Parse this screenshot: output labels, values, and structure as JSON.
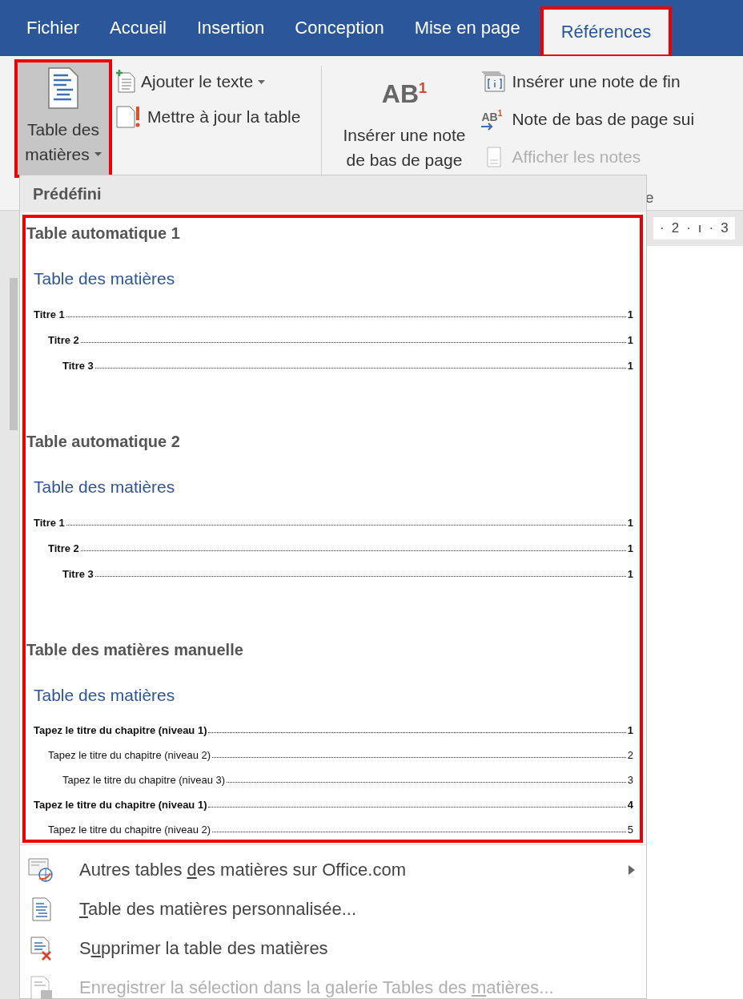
{
  "tabs": [
    {
      "label": "Fichier",
      "selected": false,
      "annotated": false
    },
    {
      "label": "Accueil",
      "selected": false,
      "annotated": false
    },
    {
      "label": "Insertion",
      "selected": false,
      "annotated": false
    },
    {
      "label": "Conception",
      "selected": false,
      "annotated": false
    },
    {
      "label": "Mise en page",
      "selected": false,
      "annotated": false
    },
    {
      "label": "Références",
      "selected": true,
      "annotated": true
    }
  ],
  "ribbon": {
    "toc_group": {
      "big_button": {
        "label_lines": [
          "Table des",
          "matières"
        ],
        "caret": true,
        "pressed": true,
        "annotated": true
      },
      "small_buttons": [
        {
          "label": "Ajouter le texte",
          "caret": true,
          "disabled": false
        },
        {
          "label": "Mettre à jour la table",
          "caret": false,
          "disabled": false
        }
      ]
    },
    "notes_group": {
      "big_button": {
        "icon_text": "AB$^{1}$",
        "label_lines": [
          "Insérer une note",
          "de bas de page"
        ]
      },
      "small_buttons": [
        {
          "label": "Insérer une note de fin",
          "disabled": false
        },
        {
          "label": "Note de bas de page sui",
          "icon_text": "AB$^{1}$",
          "disabled": false
        },
        {
          "label": "Afficher les notes",
          "disabled": true
        }
      ],
      "label": "e"
    }
  },
  "ruler": {
    "marks": [
      "·",
      "2",
      "·",
      "ı",
      "·",
      "3"
    ]
  },
  "dropdown": {
    "header": "Prédéfini",
    "gallery_annotated": true,
    "gallery": [
      {
        "title": "Table automatique 1",
        "heading": "Table des matières",
        "entries": [
          {
            "text": "Titre 1",
            "page": "1",
            "bold": true,
            "children": [
              {
                "text": "Titre 2",
                "page": "1",
                "bold": true,
                "children": [
                  {
                    "text": "Titre 3",
                    "page": "1",
                    "bold": true
                  }
                ]
              }
            ]
          }
        ]
      },
      {
        "title": "Table automatique 2",
        "heading": "Table des matières",
        "entries": [
          {
            "text": "Titre 1",
            "page": "1",
            "bold": true,
            "children": [
              {
                "text": "Titre 2",
                "page": "1",
                "bold": true,
                "children": [
                  {
                    "text": "Titre 3",
                    "page": "1",
                    "bold": true
                  }
                ]
              }
            ]
          }
        ]
      },
      {
        "title": "Table des matières manuelle",
        "heading": "Table des matières",
        "entries": [
          {
            "text": "Tapez le titre du chapitre (niveau 1)",
            "page": "1",
            "bold": true,
            "children": [
              {
                "text": "Tapez le titre du chapitre (niveau 2)",
                "page": "2",
                "bold": false,
                "children": [
                  {
                    "text": "Tapez le titre du chapitre (niveau 3)",
                    "page": "3",
                    "bold": false
                  }
                ]
              }
            ]
          },
          {
            "text": "Tapez le titre du chapitre (niveau 1)",
            "page": "4",
            "bold": true,
            "children": [
              {
                "text": "Tapez le titre du chapitre (niveau 2)",
                "page": "5",
                "bold": false
              }
            ]
          }
        ]
      }
    ],
    "menu_items": [
      {
        "label": [
          {
            "text": "Autres tables ",
            "access_key": false
          },
          {
            "text": "d",
            "access_key": true
          },
          {
            "text": "es matières sur Office.com",
            "access_key": false
          }
        ],
        "submenu": true,
        "disabled": false
      },
      {
        "label": [
          {
            "text": "T",
            "access_key": true
          },
          {
            "text": "able des matières personnalisée...",
            "access_key": false
          }
        ],
        "submenu": false,
        "disabled": false
      },
      {
        "label": [
          {
            "text": "S",
            "access_key": false
          },
          {
            "text": "u",
            "access_key": true
          },
          {
            "text": "pprimer la table des matières",
            "access_key": false
          }
        ],
        "submenu": false,
        "disabled": false
      },
      {
        "label": [
          {
            "text": "Enregistrer la sélection dans la galerie Tables des ",
            "access_key": false
          },
          {
            "text": "m",
            "access_key": true
          },
          {
            "text": "atières...",
            "access_key": false
          }
        ],
        "submenu": false,
        "disabled": true
      }
    ]
  }
}
